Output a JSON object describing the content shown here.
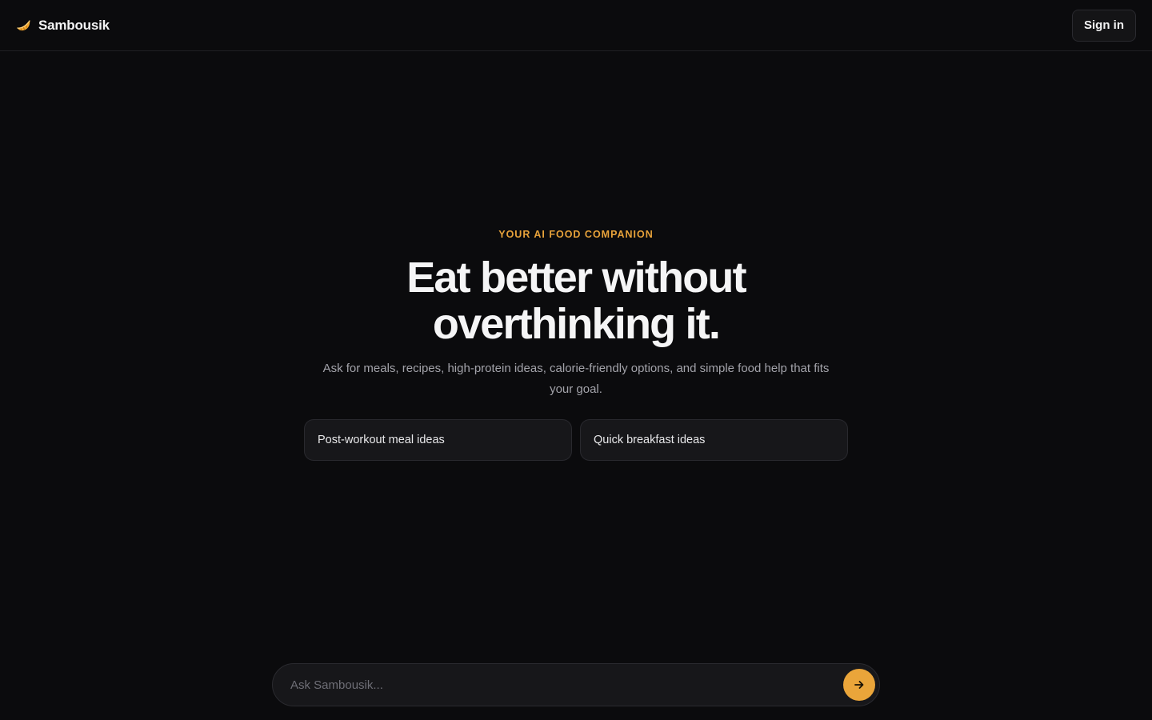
{
  "app": {
    "name": "Sambousik",
    "logo_icon": "sambousik-pastry-icon"
  },
  "header": {
    "signin_label": "Sign in"
  },
  "hero": {
    "eyebrow": "YOUR AI FOOD COMPANION",
    "headline": "Eat better without overthinking it.",
    "subtitle": "Ask for meals, recipes, high-protein ideas, calorie-friendly options, and simple food help that fits your goal."
  },
  "suggestions": [
    {
      "label": "Post-workout meal ideas"
    },
    {
      "label": "Quick breakfast ideas"
    }
  ],
  "composer": {
    "placeholder": "Ask Sambousik...",
    "send_icon": "arrow-right-icon"
  },
  "colors": {
    "background": "#0b0b0d",
    "accent": "#eaa53a",
    "surface": "#17171a",
    "border": "#2a2a2f",
    "text_muted": "#a3a3aa"
  }
}
